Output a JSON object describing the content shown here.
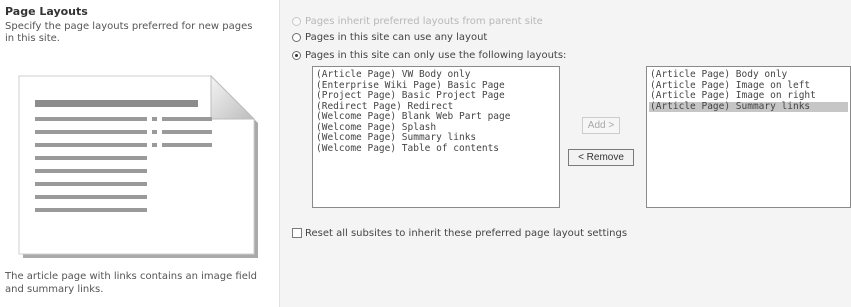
{
  "section": {
    "title": "Page Layouts",
    "description": "Specify the page layouts preferred for new pages in this site.",
    "preview_caption": "The article page with links contains an image field and summary links."
  },
  "options": {
    "inherit_label": "Pages inherit preferred layouts from parent site",
    "any_label": "Pages in this site can use any layout",
    "only_label": "Pages in this site can only use the following layouts:"
  },
  "available_layouts": [
    "(Article Page) VW Body only",
    "(Enterprise Wiki Page) Basic Page",
    "(Project Page) Basic Project Page",
    "(Redirect Page) Redirect",
    "(Welcome Page) Blank Web Part page",
    "(Welcome Page) Splash",
    "(Welcome Page) Summary links",
    "(Welcome Page) Table of contents"
  ],
  "selected_layouts": [
    "(Article Page) Body only",
    "(Article Page) Image on left",
    "(Article Page) Image on right",
    "(Article Page) Summary links"
  ],
  "buttons": {
    "add": "Add >",
    "remove": "< Remove"
  },
  "reset_label": "Reset all subsites to inherit these preferred page layout settings"
}
